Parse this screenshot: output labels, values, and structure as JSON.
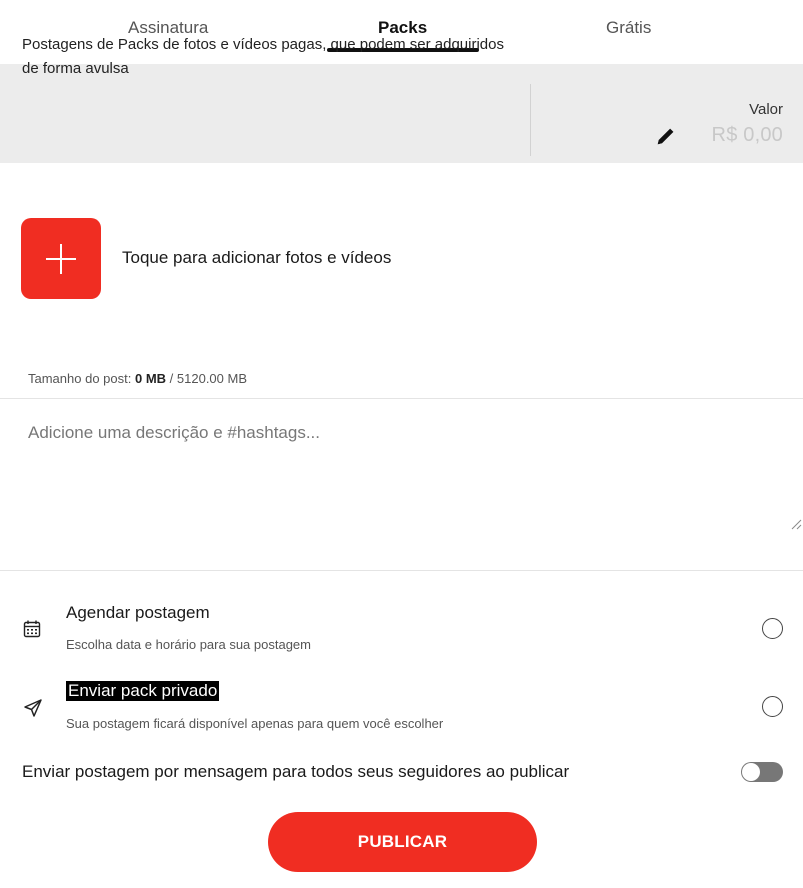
{
  "tabs": [
    {
      "label": "Assinatura",
      "active": false
    },
    {
      "label": "Packs",
      "active": true
    },
    {
      "label": "Grátis",
      "active": false
    }
  ],
  "info": {
    "description": "Postagens de Packs de fotos e vídeos pagas, que podem ser adquiridos de forma avulsa",
    "price_label": "Valor",
    "price_value": "R$ 0,00",
    "edit_icon": "pencil-icon"
  },
  "media": {
    "add_label": "Toque para adicionar fotos e vídeos",
    "add_icon": "plus-icon"
  },
  "post_size": {
    "label": "Tamanho do post:",
    "used": "0 MB",
    "limit": "/ 5120.00 MB"
  },
  "description_field": {
    "placeholder": "Adicione uma descrição e #hashtags...",
    "value": ""
  },
  "options": {
    "schedule": {
      "title": "Agendar postagem",
      "subtitle": "Escolha data e horário para sua postagem",
      "icon": "calendar-icon",
      "checked": false
    },
    "private_pack": {
      "title": "Enviar pack privado",
      "subtitle": "Sua postagem ficará disponível apenas para quem você escolher",
      "icon": "send-icon",
      "checked": false
    },
    "broadcast": {
      "label": "Enviar postagem por mensagem para todos seus seguidores ao publicar",
      "enabled": false
    }
  },
  "publish_label": "PUBLICAR",
  "colors": {
    "accent": "#f02d22",
    "band": "#ececec",
    "price_placeholder": "#c8c8c8",
    "toggle_off": "#777777"
  }
}
